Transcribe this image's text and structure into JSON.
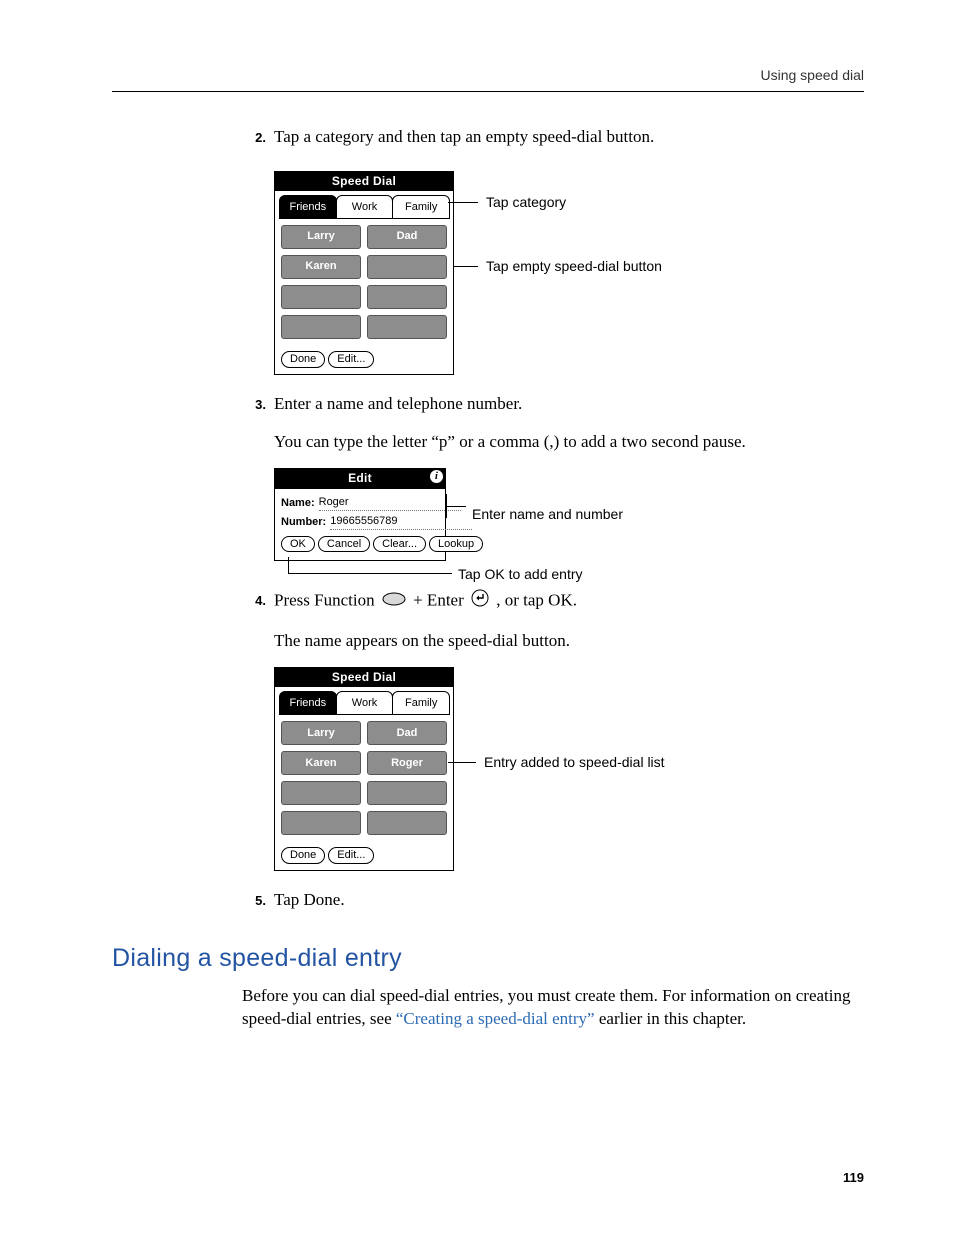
{
  "header": {
    "running_head": "Using speed dial"
  },
  "steps": {
    "s2": {
      "num": "2.",
      "text": "Tap a category and then tap an empty speed-dial button."
    },
    "s3": {
      "num": "3.",
      "text": "Enter a name and telephone number.",
      "after": "You can type the letter “p” or a comma (,) to add a two second pause."
    },
    "s4": {
      "num": "4.",
      "before_a": "Press Function ",
      "mid": " + Enter ",
      "after_a": ", or tap OK.",
      "after": "The name appears on the speed-dial button."
    },
    "s5": {
      "num": "5.",
      "text": "Tap Done."
    }
  },
  "callouts": {
    "tap_category": "Tap category",
    "tap_empty": "Tap empty speed-dial button",
    "enter_name_number": "Enter name and number",
    "tap_ok": "Tap OK to add entry",
    "entry_added": "Entry added to speed-dial list"
  },
  "phone1": {
    "title": "Speed Dial",
    "tabs": [
      "Friends",
      "Work",
      "Family"
    ],
    "active_tab_index": 0,
    "slots": [
      [
        "Larry",
        "Dad"
      ],
      [
        "Karen",
        ""
      ],
      [
        "",
        ""
      ],
      [
        "",
        ""
      ]
    ],
    "footer": {
      "done": "Done",
      "edit": "Edit..."
    }
  },
  "edit_dialog": {
    "title": "Edit",
    "name_label": "Name:",
    "number_label": "Number:",
    "name_value": "Roger",
    "number_value": "19665556789",
    "buttons": {
      "ok": "OK",
      "cancel": "Cancel",
      "clear": "Clear...",
      "lookup": "Lookup"
    }
  },
  "phone2": {
    "title": "Speed Dial",
    "tabs": [
      "Friends",
      "Work",
      "Family"
    ],
    "active_tab_index": 0,
    "slots": [
      [
        "Larry",
        "Dad"
      ],
      [
        "Karen",
        "Roger"
      ],
      [
        "",
        ""
      ],
      [
        "",
        ""
      ]
    ],
    "footer": {
      "done": "Done",
      "edit": "Edit..."
    }
  },
  "section": {
    "heading": "Dialing a speed-dial entry",
    "para_a": "Before you can dial speed-dial entries, you must create them. For information on creating speed-dial entries, see ",
    "link": "“Creating a speed-dial entry”",
    "para_b": " earlier in this chapter."
  },
  "page_number": "119"
}
